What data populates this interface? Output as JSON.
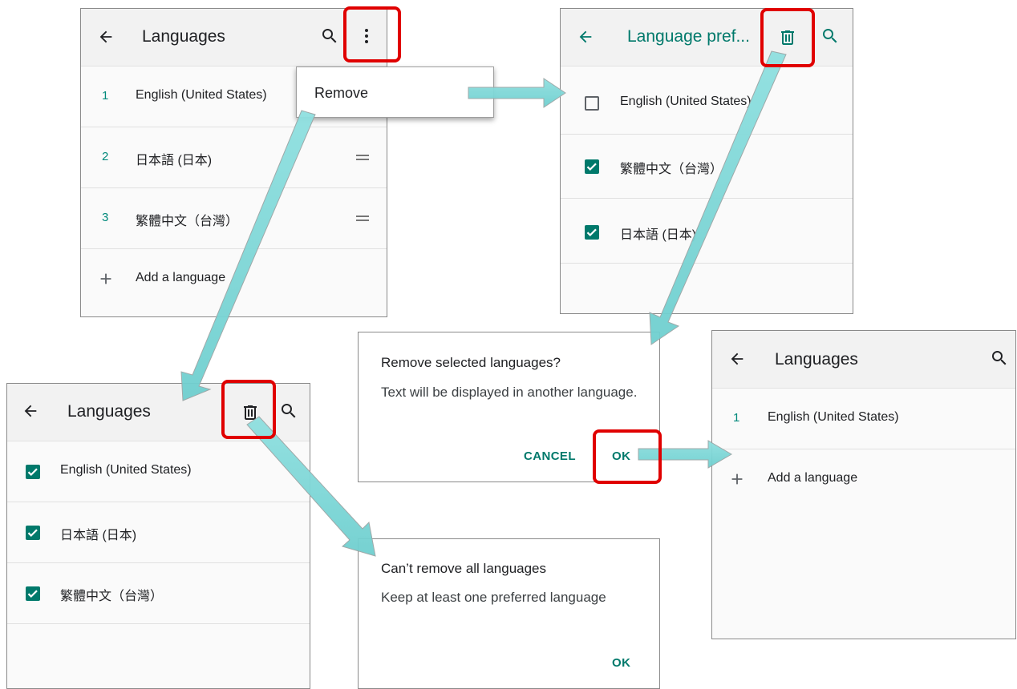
{
  "colors": {
    "accent": "#00796b",
    "highlight": "#e00000",
    "arrow": "#7fd8d8"
  },
  "panel1": {
    "title": "Languages",
    "icons": [
      "back-arrow-icon",
      "search-icon",
      "more-vert-icon"
    ],
    "items": [
      {
        "num": "1",
        "label": "English (United States)"
      },
      {
        "num": "2",
        "label": "日本語 (日本)"
      },
      {
        "num": "3",
        "label": "繁體中文（台灣）"
      }
    ],
    "add_label": "Add a language",
    "menu_item": "Remove"
  },
  "panel2": {
    "title": "Language pref...",
    "icons": [
      "back-arrow-icon",
      "delete-icon",
      "search-icon"
    ],
    "items": [
      {
        "label": "English (United States)",
        "checked": false
      },
      {
        "label": "繁體中文（台灣）",
        "checked": true
      },
      {
        "label": "日本語 (日本)",
        "checked": true
      }
    ]
  },
  "panel3": {
    "title": "Languages",
    "icons": [
      "back-arrow-icon",
      "delete-icon",
      "search-icon"
    ],
    "items": [
      {
        "label": "English (United States)",
        "checked": true
      },
      {
        "label": "日本語 (日本)",
        "checked": true
      },
      {
        "label": "繁體中文（台灣）",
        "checked": true
      }
    ]
  },
  "dialog_remove": {
    "title": "Remove selected languages?",
    "message": "Text will be displayed in another language.",
    "cancel": "CANCEL",
    "ok": "OK"
  },
  "dialog_cant": {
    "title": "Can’t remove all languages",
    "message": "Keep at least one preferred language",
    "ok": "OK"
  },
  "panel4": {
    "title": "Languages",
    "icons": [
      "back-arrow-icon",
      "search-icon"
    ],
    "items": [
      {
        "num": "1",
        "label": "English (United States)"
      }
    ],
    "add_label": "Add a language"
  }
}
